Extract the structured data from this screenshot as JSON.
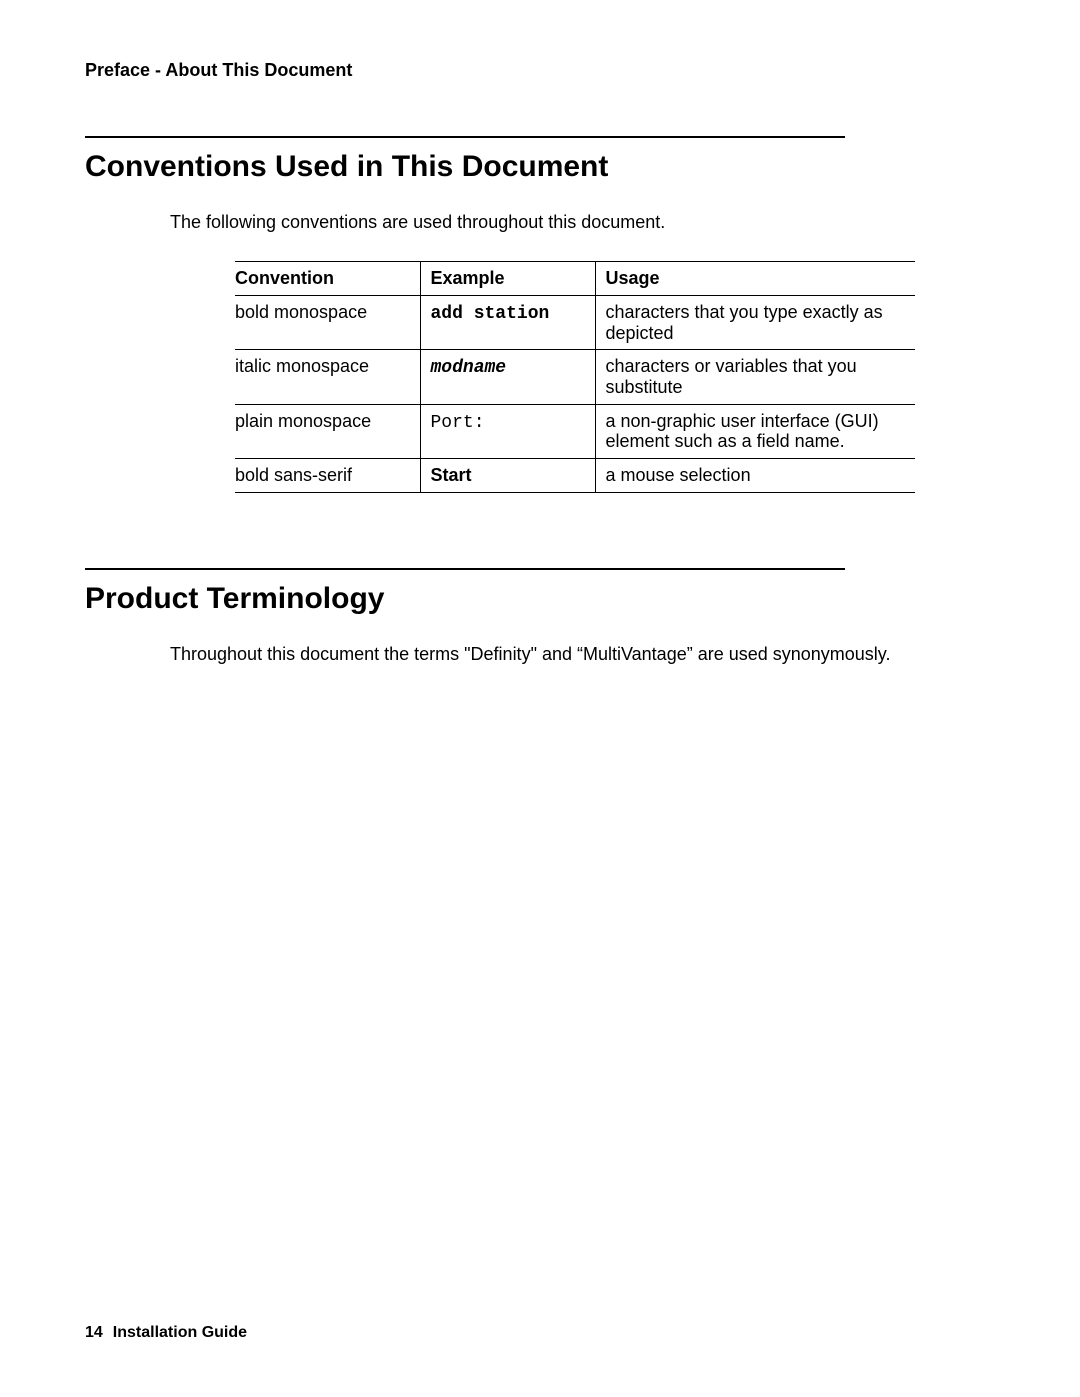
{
  "header": {
    "text": "Preface - About This Document"
  },
  "section1": {
    "title": "Conventions Used in This Document",
    "intro": "The following conventions are used throughout this document.",
    "table": {
      "headers": {
        "convention": "Convention",
        "example": "Example",
        "usage": "Usage"
      },
      "rows": [
        {
          "convention": "bold monospace",
          "example": "add station",
          "exClass": "mono bold",
          "usage": "characters that you type exactly as depicted"
        },
        {
          "convention": "italic monospace",
          "example": "modname",
          "exClass": "mono bold ital",
          "usage": "characters or variables that you substitute"
        },
        {
          "convention": "plain monospace",
          "example": "Port:",
          "exClass": "mono",
          "usage": "a non-graphic user interface (GUI) element such as a field name."
        },
        {
          "convention": "bold sans-serif",
          "example": "Start",
          "exClass": "bold",
          "usage": "a mouse selection"
        }
      ]
    }
  },
  "section2": {
    "title": "Product Terminology",
    "text": "Throughout this document the terms \"Definity\" and “MultiVantage” are used synonymously."
  },
  "footer": {
    "page": "14",
    "title": "Installation Guide"
  }
}
